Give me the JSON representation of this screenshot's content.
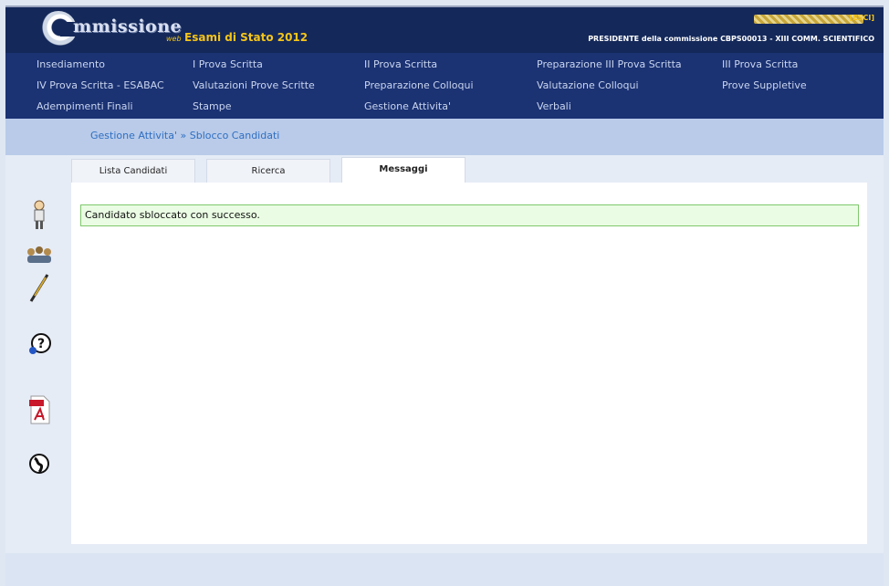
{
  "header": {
    "logo_text": "mmissione",
    "logo_sub": "web",
    "exam_title": "Esami di Stato 2012",
    "logout": "[ESCI]",
    "role": "PRESIDENTE della commissione CBPS00013 - XIII COMM. SCIENTIFICO"
  },
  "menu": {
    "items": [
      "Insediamento",
      "I Prova Scritta",
      "II Prova Scritta",
      "Preparazione III Prova Scritta",
      "III Prova Scritta",
      "IV Prova Scritta - ESABAC",
      "Valutazioni Prove Scritte",
      "Preparazione Colloqui",
      "Valutazione Colloqui",
      "Prove Suppletive",
      "Adempimenti Finali",
      "Stampe",
      "Gestione Attivita'",
      "Verbali"
    ]
  },
  "breadcrumb": "Gestione Attivita' » Sblocco Candidati",
  "tabs": [
    "Lista Candidati",
    "Ricerca",
    "Messaggi"
  ],
  "message": "Candidato sbloccato con successo.",
  "icons": {
    "side": [
      "user-figure-icon",
      "commission-people-icon",
      "pen-icon",
      "help-icon",
      "pdf-icon",
      "globe-icon"
    ]
  }
}
